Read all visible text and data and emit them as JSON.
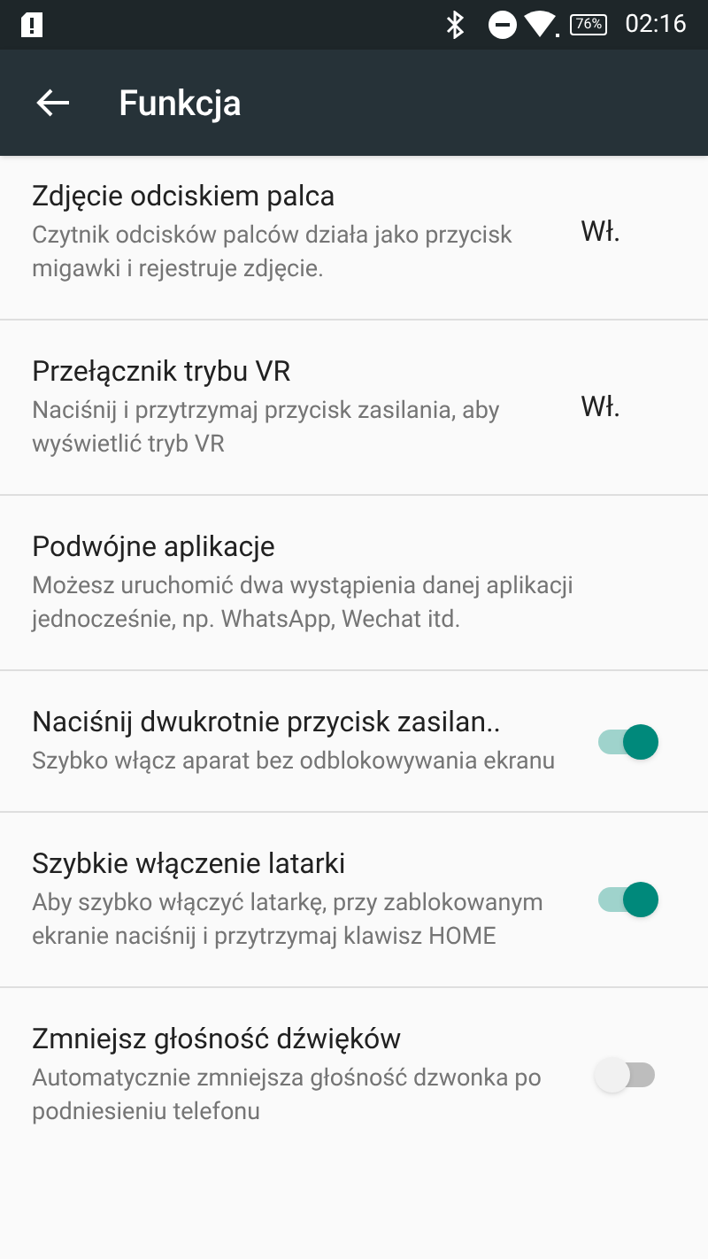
{
  "status_bar": {
    "battery": "76%",
    "time": "02:16"
  },
  "app_bar": {
    "title": "Funkcja"
  },
  "settings": [
    {
      "kind": "value",
      "title": "Zdjęcie odciskiem palca",
      "summary": "Czytnik odcisków palców działa jako przycisk migawki i rejestruje zdjęcie.",
      "value": "Wł."
    },
    {
      "kind": "value",
      "title": "Przełącznik trybu VR",
      "summary": "Naciśnij i przytrzymaj przycisk zasilania, aby wyświetlić tryb VR",
      "value": "Wł."
    },
    {
      "kind": "plain",
      "title": "Podwójne aplikacje",
      "summary": "Możesz uruchomić dwa wystąpienia danej aplikacji jednocześnie, np. WhatsApp, Wechat itd."
    },
    {
      "kind": "switch",
      "title": "Naciśnij dwukrotnie przycisk zasilan..",
      "summary": "Szybko włącz aparat bez odblokowywania ekranu",
      "on": true
    },
    {
      "kind": "switch",
      "title": "Szybkie włączenie latarki",
      "summary": "Aby szybko włączyć latarkę, przy zablokowanym ekranie naciśnij i przytrzymaj klawisz HOME",
      "on": true
    },
    {
      "kind": "switch",
      "title": "Zmniejsz głośność dźwięków",
      "summary": "Automatycznie zmniejsza głośność dzwonka po podniesieniu telefonu",
      "on": false
    }
  ]
}
